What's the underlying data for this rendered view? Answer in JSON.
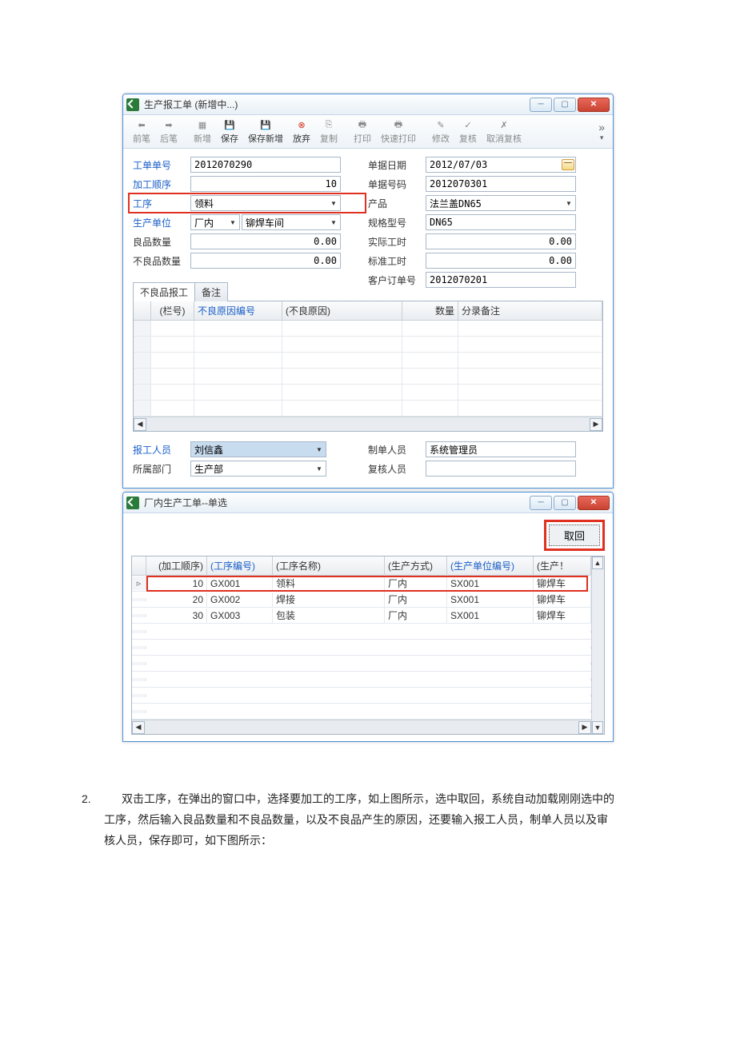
{
  "window1": {
    "title": "生产报工单 (新增中...)",
    "toolbar": {
      "prev": "前笔",
      "next": "后笔",
      "new": "新增",
      "save": "保存",
      "save_new": "保存新增",
      "discard": "放弃",
      "copy": "复制",
      "print": "打印",
      "quick_print": "快速打印",
      "edit": "修改",
      "review": "复核",
      "unreview": "取消复核"
    },
    "labels": {
      "order_no": "工单单号",
      "proc_seq": "加工顺序",
      "process": "工序",
      "prod_unit": "生产单位",
      "good_qty": "良品数量",
      "bad_qty": "不良品数量",
      "doc_date": "单据日期",
      "doc_no": "单据号码",
      "product": "产品",
      "spec": "规格型号",
      "actual_hours": "实际工时",
      "std_hours": "标准工时",
      "cust_order": "客户订单号",
      "reporter": "报工人员",
      "dept": "所属部门",
      "maker": "制单人员",
      "reviewer": "复核人员"
    },
    "values": {
      "order_no": "2012070290",
      "proc_seq": "10",
      "process": "领料",
      "prod_unit_a": "厂内",
      "prod_unit_b": "铆焊车间",
      "good_qty": "0.00",
      "bad_qty": "0.00",
      "doc_date": "2012/07/03",
      "doc_no": "2012070301",
      "product": "法兰盖DN65",
      "spec": "DN65",
      "actual_hours": "0.00",
      "std_hours": "0.00",
      "cust_order": "2012070201",
      "reporter": "刘信鑫",
      "dept": "生产部",
      "maker": "系统管理员",
      "reviewer": ""
    },
    "tabs": {
      "tab1": "不良品报工",
      "tab2": "备注"
    },
    "grid_headers": {
      "col1": "(栏号)",
      "col2": "不良原因编号",
      "col3": "(不良原因)",
      "col4": "数量",
      "col5": "分录备注"
    }
  },
  "window2": {
    "title": "厂内生产工单--单选",
    "btn_get": "取回",
    "headers": {
      "seq": "(加工顺序)",
      "code": "(工序编号)",
      "name": "(工序名称)",
      "mode": "(生产方式)",
      "unit_code": "(生产单位编号)",
      "unit": "(生产！"
    },
    "rows": [
      {
        "seq": "10",
        "code": "GX001",
        "name": "领料",
        "mode": "厂内",
        "unit_code": "SX001",
        "unit": "铆焊车"
      },
      {
        "seq": "20",
        "code": "GX002",
        "name": "焊接",
        "mode": "厂内",
        "unit_code": "SX001",
        "unit": "铆焊车"
      },
      {
        "seq": "30",
        "code": "GX003",
        "name": "包装",
        "mode": "厂内",
        "unit_code": "SX001",
        "unit": "铆焊车"
      }
    ]
  },
  "instruction": {
    "num": "2.",
    "text": "双击工序，在弹出的窗口中，选择要加工的工序，如上图所示，选中取回，系统自动加载刚刚选中的工序，然后输入良品数量和不良品数量，以及不良品产生的原因，还要输入报工人员，制单人员以及审核人员，保存即可，如下图所示："
  }
}
